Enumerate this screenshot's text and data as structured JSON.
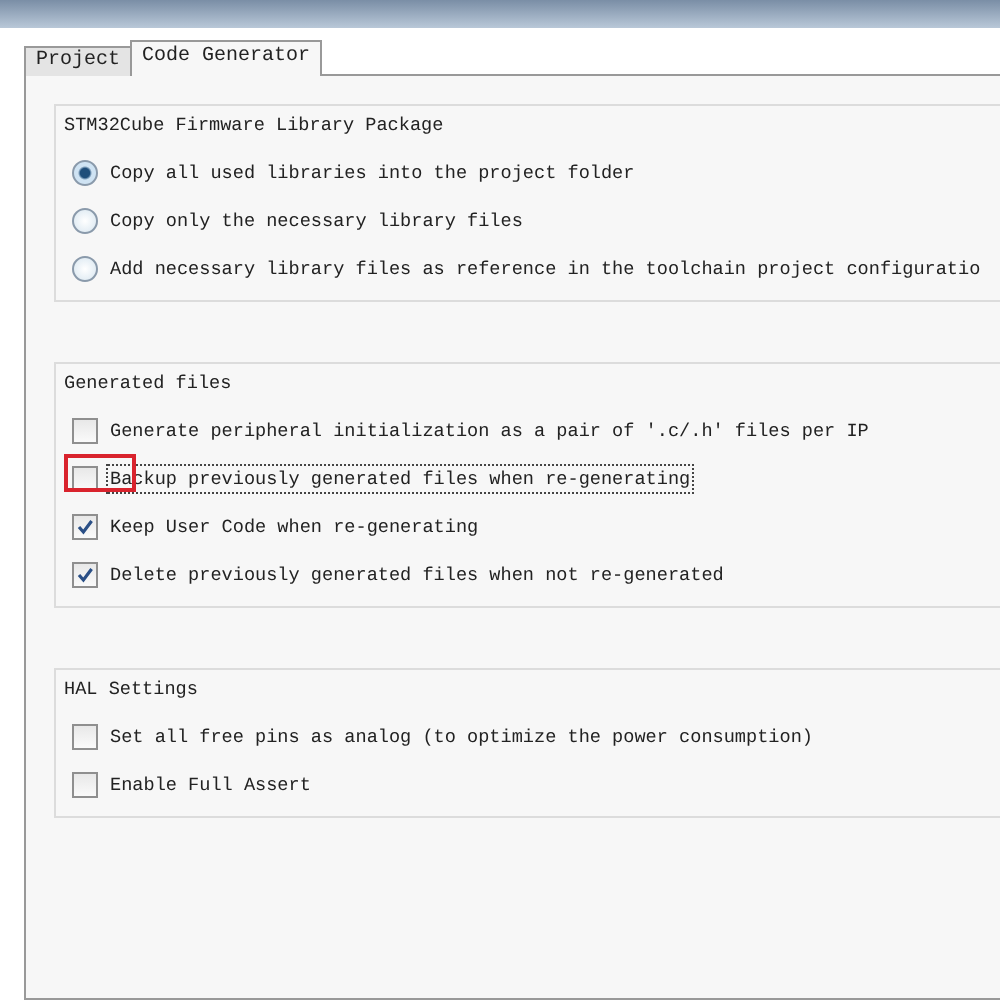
{
  "tabs": [
    {
      "label": "Project",
      "selected": false
    },
    {
      "label": "Code Generator",
      "selected": true
    }
  ],
  "groups": [
    {
      "title": "STM32Cube Firmware Library Package",
      "options": [
        {
          "kind": "radio",
          "label": "Copy all used libraries into the project folder",
          "selected": true
        },
        {
          "kind": "radio",
          "label": "Copy only the necessary library files",
          "selected": false
        },
        {
          "kind": "radio",
          "label": "Add necessary library files as reference in the toolchain project configuratio",
          "selected": false
        }
      ]
    },
    {
      "title": "Generated files",
      "options": [
        {
          "kind": "checkbox",
          "label": "Generate peripheral initialization as a pair of '.c/.h' files per IP",
          "checked": false,
          "focused": false,
          "highlighted": false
        },
        {
          "kind": "checkbox",
          "label": "Backup previously generated files when re-generating",
          "checked": false,
          "focused": true,
          "highlighted": true
        },
        {
          "kind": "checkbox",
          "label": "Keep User Code when re-generating",
          "checked": true,
          "focused": false,
          "highlighted": false
        },
        {
          "kind": "checkbox",
          "label": "Delete previously generated files when not re-generated",
          "checked": true,
          "focused": false,
          "highlighted": false
        }
      ]
    },
    {
      "title": "HAL Settings",
      "options": [
        {
          "kind": "checkbox",
          "label": "Set all free pins as analog (to optimize the power consumption)",
          "checked": false,
          "focused": false,
          "highlighted": false
        },
        {
          "kind": "checkbox",
          "label": "Enable Full Assert",
          "checked": false,
          "focused": false,
          "highlighted": false
        }
      ]
    }
  ]
}
